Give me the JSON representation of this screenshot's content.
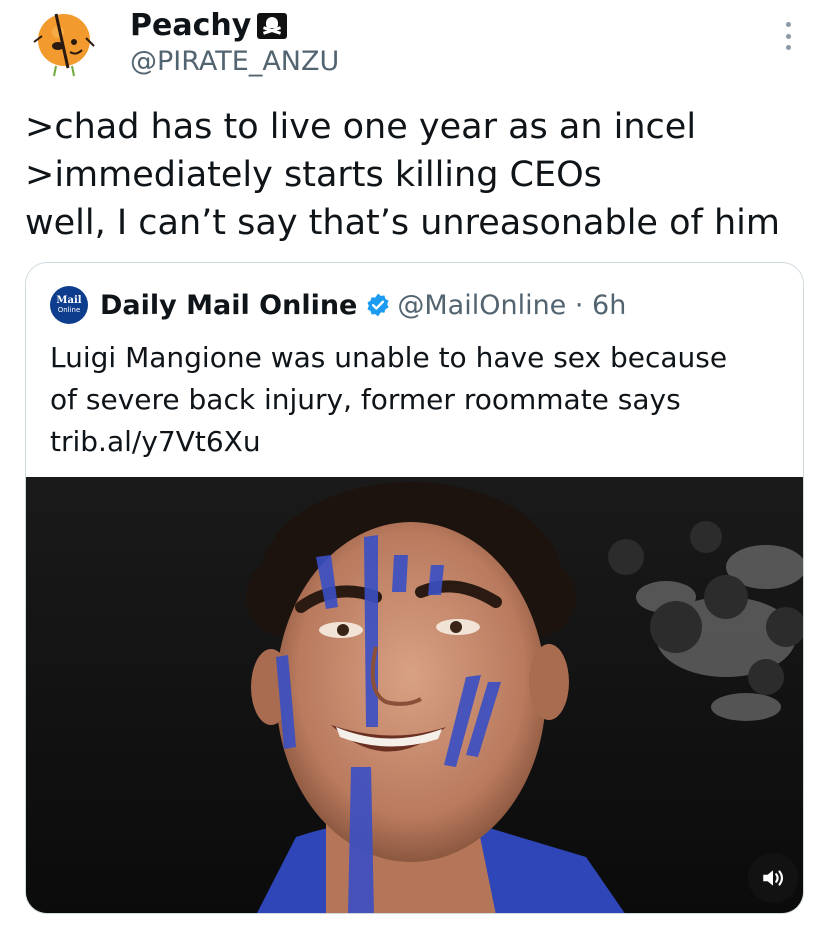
{
  "author": {
    "display_name": "Peachy",
    "badge_icon": "pirate-flag-icon",
    "handle": "@PIRATE_ANZU",
    "avatar_icon": "peach-pirate-avatar"
  },
  "tweet": {
    "lines": [
      ">chad has to live one year as an incel",
      ">immediately starts killing CEOs",
      "well, I can’t say that’s unreasonable of him"
    ]
  },
  "quote": {
    "avatar": {
      "line1": "Mail",
      "line2": "Online"
    },
    "name": "Daily Mail Online",
    "verified_icon": "verified-badge-icon",
    "handle_time": "@MailOnline · 6h",
    "text_lines": [
      "Luigi Mangione was unable to have sex because",
      "of severe back injury, former roommate says",
      "trib.al/y7Vt6Xu"
    ],
    "media": {
      "type": "photo",
      "mute_icon": "speaker-icon"
    }
  },
  "colors": {
    "text": "#0f1419",
    "secondary": "#536471",
    "border": "#cfd9de",
    "verified": "#1d9bf0",
    "face_paint": "#3a4fc4",
    "avatar_peach": "#f39a2e"
  }
}
